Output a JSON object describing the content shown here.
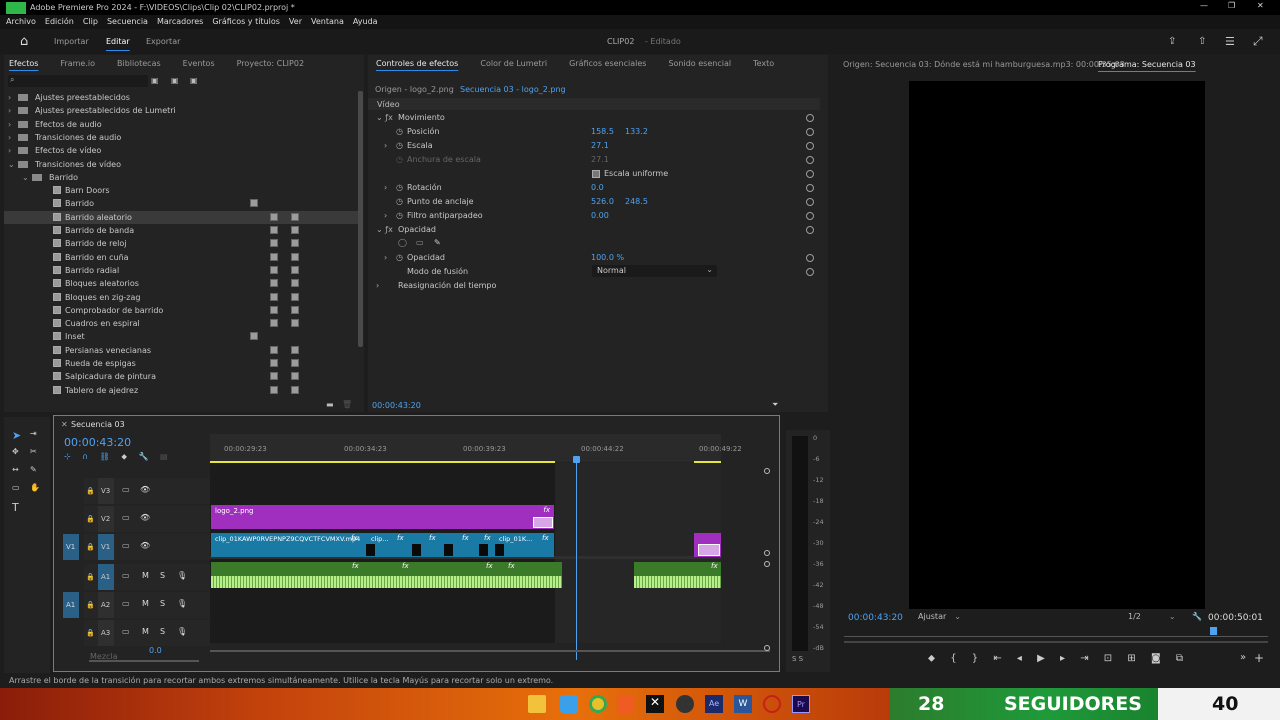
{
  "app": {
    "title": "Adobe Premiere Pro 2024 - F:\\VIDEOS\\Clips\\Clip 02\\CLIP02.prproj *",
    "project_name": "CLIP02",
    "project_state": "- Editado"
  },
  "menu": [
    "Archivo",
    "Edición",
    "Clip",
    "Secuencia",
    "Marcadores",
    "Gráficos y títulos",
    "Ver",
    "Ventana",
    "Ayuda"
  ],
  "workspace": {
    "items": [
      "Importar",
      "Editar",
      "Exportar"
    ],
    "active": "Editar"
  },
  "effects_panel": {
    "tabs": [
      "Efectos",
      "Frame.io",
      "Bibliotecas",
      "Eventos",
      "Proyecto: CLIP02"
    ],
    "tree": [
      {
        "label": "Ajustes preestablecidos",
        "level": 0
      },
      {
        "label": "Ajustes preestablecidos de Lumetri",
        "level": 0
      },
      {
        "label": "Efectos de audio",
        "level": 0
      },
      {
        "label": "Transiciones de audio",
        "level": 0
      },
      {
        "label": "Efectos de vídeo",
        "level": 0
      },
      {
        "label": "Transiciones de vídeo",
        "level": 0,
        "open": true
      },
      {
        "label": "Barrido",
        "level": 1,
        "open": true
      },
      {
        "label": "Barn Doors",
        "level": 2
      },
      {
        "label": "Barrido",
        "level": 2
      },
      {
        "label": "Barrido aleatorio",
        "level": 2,
        "selected": true
      },
      {
        "label": "Barrido de banda",
        "level": 2
      },
      {
        "label": "Barrido de reloj",
        "level": 2
      },
      {
        "label": "Barrido en cuña",
        "level": 2
      },
      {
        "label": "Barrido radial",
        "level": 2
      },
      {
        "label": "Bloques aleatorios",
        "level": 2
      },
      {
        "label": "Bloques en zig-zag",
        "level": 2
      },
      {
        "label": "Comprobador de barrido",
        "level": 2
      },
      {
        "label": "Cuadros en espiral",
        "level": 2
      },
      {
        "label": "Inset",
        "level": 2
      },
      {
        "label": "Persianas venecianas",
        "level": 2
      },
      {
        "label": "Rueda de espigas",
        "level": 2
      },
      {
        "label": "Salpicadura de pintura",
        "level": 2
      },
      {
        "label": "Tablero de ajedrez",
        "level": 2
      }
    ]
  },
  "effect_controls": {
    "tabs": [
      "Controles de efectos",
      "Color de Lumetri",
      "Gráficos esenciales",
      "Sonido esencial",
      "Texto"
    ],
    "source": "Origen - logo_2.png",
    "sequence": "Secuencia 03 - logo_2.png",
    "section_video": "Vídeo",
    "movimiento": "Movimiento",
    "posicion": {
      "label": "Posición",
      "x": "158.5",
      "y": "133.2"
    },
    "escala": {
      "label": "Escala",
      "value": "27.1"
    },
    "anchura": {
      "label": "Anchura de escala",
      "value": "27.1"
    },
    "uniforme": "Escala uniforme",
    "rotacion": {
      "label": "Rotación",
      "value": "0.0"
    },
    "anclaje": {
      "label": "Punto de anclaje",
      "x": "526.0",
      "y": "248.5"
    },
    "antiparpadeo": {
      "label": "Filtro antiparpadeo",
      "value": "0.00"
    },
    "opacidad_section": "Opacidad",
    "opacidad": {
      "label": "Opacidad",
      "value": "100.0 %"
    },
    "modo": {
      "label": "Modo de fusión",
      "value": "Normal"
    },
    "tiempo": "Reasignación del tiempo",
    "timecode": "00:00:43:20"
  },
  "program": {
    "source_label": "Origen: Secuencia 03: Dónde está mi hamburguesa.mp3: 00:00:35:03",
    "tab": "Programa: Secuencia 03",
    "timecode": "00:00:43:20",
    "fit": "Ajustar",
    "quality": "1/2",
    "duration": "00:00:50:01"
  },
  "timeline": {
    "tab": "Secuencia 03",
    "timecode": "00:00:43:20",
    "ruler": [
      "00:00:29:23",
      "00:00:34:23",
      "00:00:39:23",
      "00:00:44:22",
      "00:00:49:22"
    ],
    "video_tracks": [
      "V3",
      "V2",
      "V1"
    ],
    "audio_tracks": [
      "A1",
      "A2",
      "A3"
    ],
    "src_v": "V1",
    "src_a": "A1",
    "clips": {
      "logo": "logo_2.png",
      "main": "clip_01KAWP0RVEPNPZ9CQVCTFCVMXV.mp4",
      "c2": "clip...",
      "c3": "clip_01K..."
    },
    "mezcla": "Mezcla",
    "mezcla_val": "0.0",
    "fx": "fx"
  },
  "meter": {
    "scale": [
      "0",
      "-6",
      "-12",
      "-18",
      "-24",
      "-30",
      "-36",
      "-42",
      "-48",
      "-54",
      "-dB"
    ],
    "solo": "S S"
  },
  "status": "Arrastre el borde de la transición para recortar ambos extremos simultáneamente. Utilice la tecla Mayús para recortar solo un extremo.",
  "taskbar": {
    "followers_left": "28",
    "followers_label": "SEGUIDORES",
    "followers_right": "40"
  }
}
